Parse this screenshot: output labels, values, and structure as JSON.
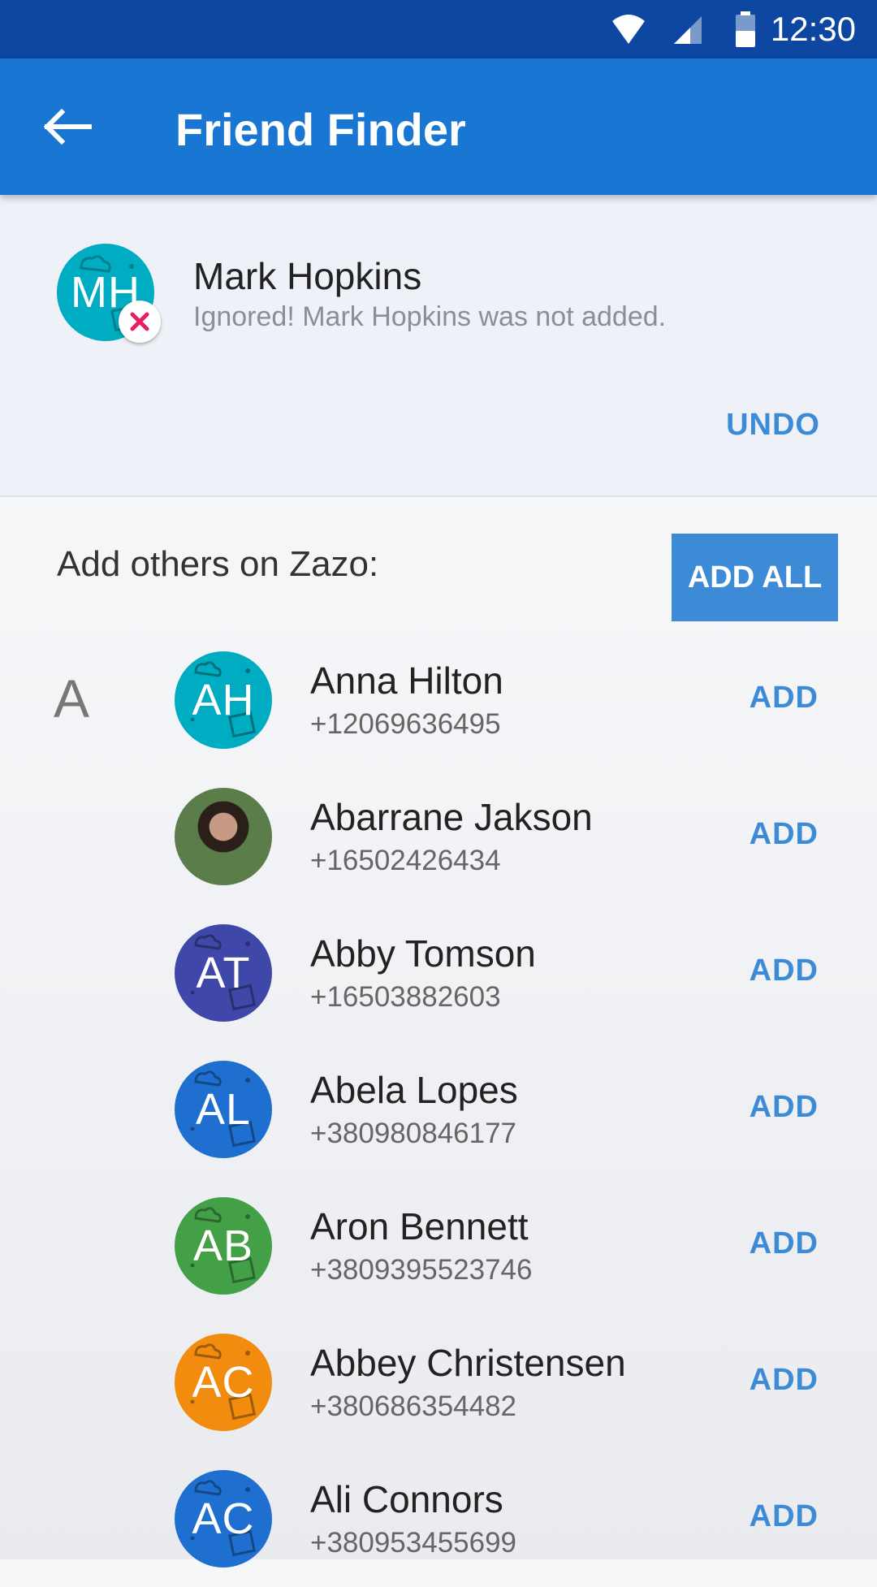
{
  "status_bar": {
    "time": "12:30",
    "icons": [
      "wifi-icon",
      "cell-signal-icon",
      "battery-icon"
    ]
  },
  "app_bar": {
    "back_icon": "arrow-left-icon",
    "title": "Friend Finder"
  },
  "ignored": {
    "initials": "MH",
    "avatar_color": "#00acc1",
    "name": "Mark Hopkins",
    "message": "Ignored!  Mark Hopkins was not added.",
    "badge_icon": "close-icon",
    "undo_label": "UNDO"
  },
  "add_section": {
    "label": "Add others on Zazo:",
    "add_all_label": "ADD ALL",
    "index_letter": "A",
    "add_label": "ADD"
  },
  "contacts": [
    {
      "initials": "AH",
      "name": "Anna Hilton",
      "phone": "+12069636495",
      "color": "#00acc1"
    },
    {
      "initials": "",
      "name": "Abarrane Jakson",
      "phone": "+16502426434",
      "color": "#5a7d4a",
      "photo": true
    },
    {
      "initials": "AT",
      "name": "Abby Tomson",
      "phone": "+16503882603",
      "color": "#3f48a8"
    },
    {
      "initials": "AL",
      "name": "Abela Lopes",
      "phone": "+380980846177",
      "color": "#1e6fcf"
    },
    {
      "initials": "AB",
      "name": "Aron Bennett",
      "phone": "+3809395523746",
      "color": "#43a047"
    },
    {
      "initials": "AC",
      "name": "Abbey Christensen",
      "phone": "+380686354482",
      "color": "#f28c0f"
    },
    {
      "initials": "AC",
      "name": "Ali Connors",
      "phone": "+380953455699",
      "color": "#1e6fcf"
    }
  ],
  "colors": {
    "status_bar": "#0d47a1",
    "app_bar": "#1976d2",
    "accent": "#3d8ad6",
    "badge_x": "#e91e63"
  }
}
